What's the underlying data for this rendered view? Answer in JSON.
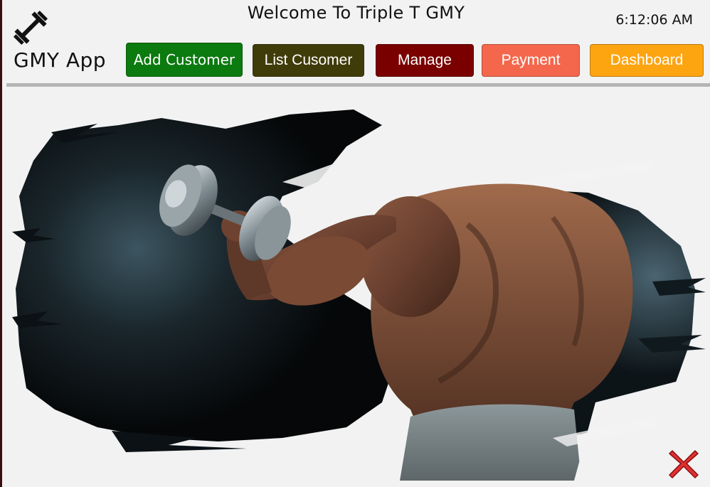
{
  "header": {
    "app_name": "GMY App",
    "welcome": "Welcome To Triple T GMY",
    "time": "6:12:06 AM",
    "logo_icon": "dumbbell-icon"
  },
  "nav": {
    "add_customer": "Add  Customer",
    "list_customer": "List Cusomer",
    "manage": "Manage",
    "payment": "Payment",
    "dashboard": "Dashboard"
  },
  "colors": {
    "add_customer": "#0b7a0f",
    "list_customer": "#3f3c0a",
    "manage": "#7a0000",
    "payment": "#f4674c",
    "dashboard": "#fda411",
    "close": "#e03030"
  },
  "hero": {
    "image": "bodybuilder-with-dumbbell"
  },
  "close": {
    "icon": "close-icon"
  }
}
